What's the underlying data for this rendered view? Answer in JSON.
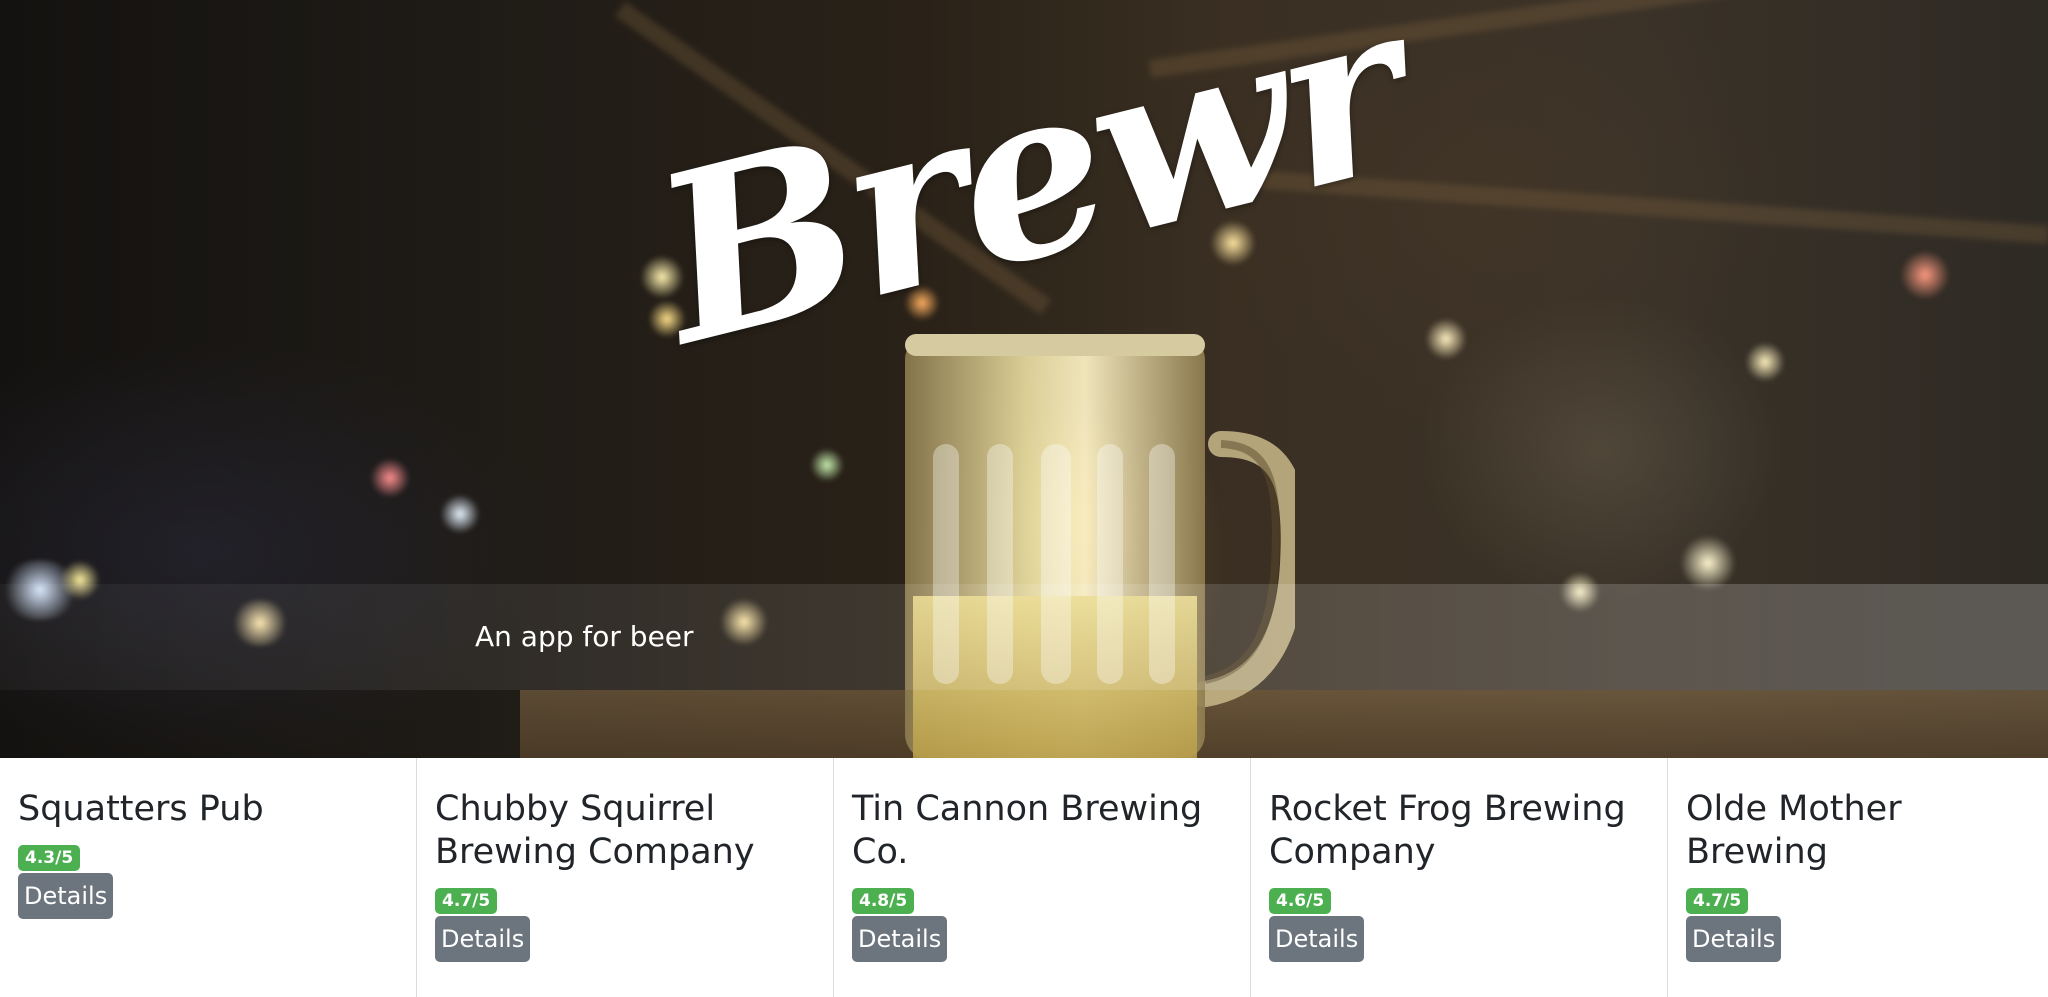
{
  "hero": {
    "logo_text": "Brewr",
    "tagline": "An app for beer"
  },
  "brewery_cards": [
    {
      "name": "Squatters Pub",
      "rating": "4.3/5",
      "details_label": "Details"
    },
    {
      "name": "Chubby Squirrel Brewing Company",
      "rating": "4.7/5",
      "details_label": "Details"
    },
    {
      "name": "Tin Cannon Brewing Co.",
      "rating": "4.8/5",
      "details_label": "Details"
    },
    {
      "name": "Rocket Frog Brewing Company",
      "rating": "4.6/5",
      "details_label": "Details"
    },
    {
      "name": "Olde Mother Brewing",
      "rating": "4.7/5",
      "details_label": "Details"
    }
  ],
  "colors": {
    "rating_badge": "#4caf50",
    "details_button": "#6c757d",
    "title_text": "#212529"
  }
}
